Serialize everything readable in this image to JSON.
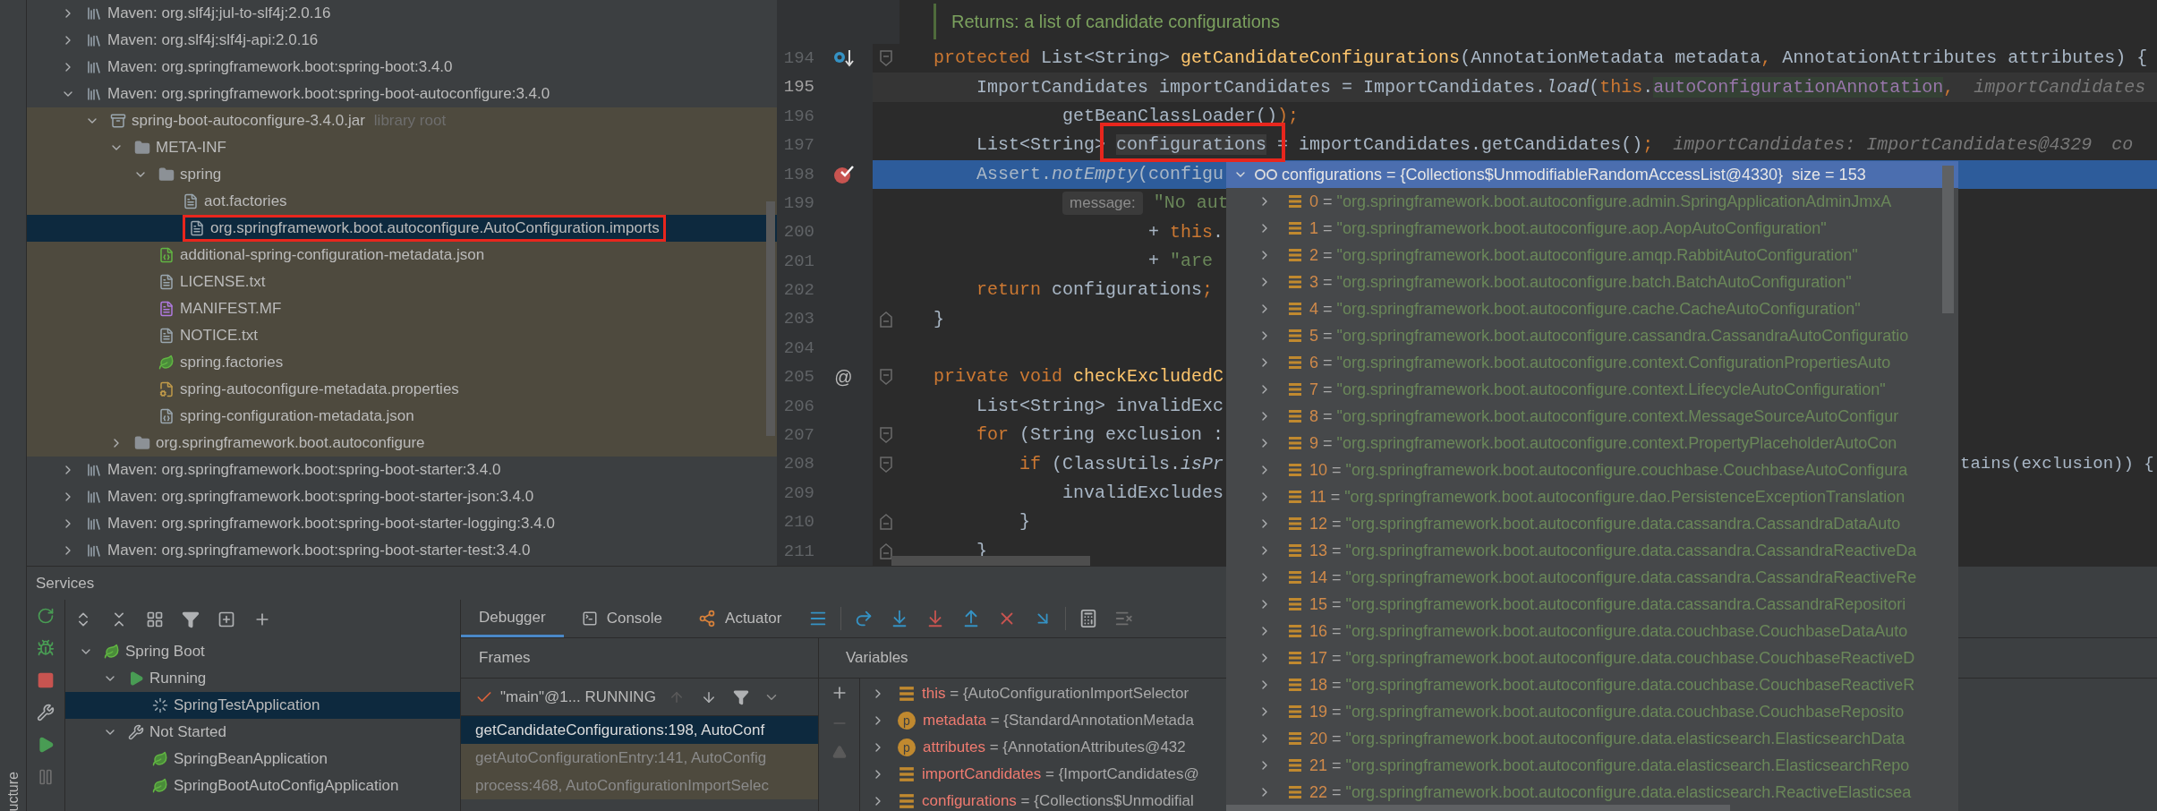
{
  "side_strip": {
    "label": "ucture"
  },
  "project_tree": [
    {
      "label": "Maven: org.slf4j:jul-to-slf4j:2.0.16",
      "kind": "library",
      "expanded": false,
      "selected": false
    },
    {
      "label": "Maven: org.slf4j:slf4j-api:2.0.16",
      "kind": "library",
      "expanded": false,
      "selected": false
    },
    {
      "label": "Maven: org.springframework.boot:spring-boot:3.4.0",
      "kind": "library",
      "expanded": false,
      "selected": false
    },
    {
      "label": "Maven: org.springframework.boot:spring-boot-autoconfigure:3.4.0",
      "kind": "library",
      "expanded": true,
      "selected": false,
      "children": [
        {
          "label": "spring-boot-autoconfigure-3.4.0.jar",
          "hint": "library root",
          "kind": "jar",
          "in_library": true,
          "expanded": true,
          "selected": false,
          "children": [
            {
              "label": "META-INF",
              "kind": "folder",
              "expanded": true,
              "selected": false,
              "children": [
                {
                  "label": "spring",
                  "kind": "folder",
                  "expanded": true,
                  "selected": false,
                  "children": [
                    {
                      "label": "aot.factories",
                      "kind": "file",
                      "selected": false
                    },
                    {
                      "label": "org.springframework.boot.autoconfigure.AutoConfiguration.imports",
                      "kind": "file",
                      "selected": true,
                      "framed": true
                    }
                  ]
                },
                {
                  "label": "additional-spring-configuration-metadata.json",
                  "kind": "spring_json",
                  "selected": false
                },
                {
                  "label": "LICENSE.txt",
                  "kind": "file",
                  "selected": false
                },
                {
                  "label": "MANIFEST.MF",
                  "kind": "manifest",
                  "selected": false
                },
                {
                  "label": "NOTICE.txt",
                  "kind": "file",
                  "selected": false
                },
                {
                  "label": "spring.factories",
                  "kind": "spring",
                  "selected": false
                },
                {
                  "label": "spring-autoconfigure-metadata.properties",
                  "kind": "properties",
                  "selected": false
                },
                {
                  "label": "spring-configuration-metadata.json",
                  "kind": "json",
                  "selected": false
                }
              ]
            },
            {
              "label": "org.springframework.boot.autoconfigure",
              "kind": "folder",
              "expanded": false,
              "selected": false
            }
          ]
        }
      ]
    },
    {
      "label": "Maven: org.springframework.boot:spring-boot-starter:3.4.0",
      "kind": "library",
      "expanded": false,
      "selected": false
    },
    {
      "label": "Maven: org.springframework.boot:spring-boot-starter-json:3.4.0",
      "kind": "library",
      "expanded": false,
      "selected": false
    },
    {
      "label": "Maven: org.springframework.boot:spring-boot-starter-logging:3.4.0",
      "kind": "library",
      "expanded": false,
      "selected": false
    },
    {
      "label": "Maven: org.springframework.boot:spring-boot-starter-test:3.4.0",
      "kind": "library",
      "expanded": false,
      "selected": false
    }
  ],
  "editor": {
    "doc_comment": "Returns: a list of candidate configurations",
    "lines": [
      {
        "number": "194",
        "current": false,
        "execution": false,
        "markers": [
          {
            "kind": "override"
          }
        ],
        "folds": [
          {
            "kind": "start"
          }
        ],
        "tokens": [
          {
            "kind": "keyword",
            "text": "protected"
          },
          {
            "kind": "plain",
            "text": " List<String> "
          },
          {
            "kind": "method",
            "text": "getCandidateConfigurations"
          },
          {
            "kind": "plain",
            "text": "(AnnotationMetadata metadata"
          },
          {
            "kind": "keyword",
            "text": ","
          },
          {
            "kind": "plain",
            "text": " AnnotationAttributes attributes) {"
          }
        ]
      },
      {
        "number": "195",
        "current": true,
        "execution": false,
        "tokens": [
          {
            "kind": "plain",
            "text": "    ImportCandidates importCandidates = ImportCandidates."
          },
          {
            "kind": "italic",
            "text": "load"
          },
          {
            "kind": "plain",
            "text": "("
          },
          {
            "kind": "keyword",
            "text": "this"
          },
          {
            "kind": "plain",
            "text": "."
          },
          {
            "kind": "field_usage",
            "text": "autoConfigurationAnnotation"
          },
          {
            "kind": "keyword",
            "text": ","
          },
          {
            "kind": "hint",
            "text": "importCandidates"
          }
        ]
      },
      {
        "number": "196",
        "current": false,
        "execution": false,
        "tokens": [
          {
            "kind": "plain",
            "text": "            getBeanClassLoader()"
          },
          {
            "kind": "keyword",
            "text": ");"
          }
        ]
      },
      {
        "number": "197",
        "current": false,
        "execution": false,
        "framed": true,
        "tokens": [
          {
            "kind": "plain",
            "text": "    List<String> "
          },
          {
            "kind": "usage",
            "text": "configurations"
          },
          {
            "kind": "plain",
            "text": " = importCandidates.getCandidates()"
          },
          {
            "kind": "keyword",
            "text": ";"
          },
          {
            "kind": "hint",
            "text": "importCandidates: ImportCandidates@4329"
          },
          {
            "kind": "hint",
            "text": "co"
          }
        ]
      },
      {
        "number": "198",
        "current": false,
        "execution": true,
        "markers": [
          {
            "kind": "breakpoint"
          }
        ],
        "tokens": [
          {
            "kind": "plain",
            "text": "    Assert."
          },
          {
            "kind": "italic",
            "text": "notEmpty"
          },
          {
            "kind": "plain",
            "text": "(configu"
          }
        ]
      },
      {
        "number": "199",
        "current": false,
        "execution": false,
        "tokens": [
          {
            "kind": "param_hint",
            "text": "            message:"
          },
          {
            "kind": "string",
            "text": "\"No aut"
          }
        ]
      },
      {
        "number": "200",
        "current": false,
        "execution": false,
        "tokens": [
          {
            "kind": "plain",
            "text": "                    + "
          },
          {
            "kind": "keyword",
            "text": "this"
          },
          {
            "kind": "plain",
            "text": "."
          }
        ]
      },
      {
        "number": "201",
        "current": false,
        "execution": false,
        "tokens": [
          {
            "kind": "plain",
            "text": "                    + "
          },
          {
            "kind": "string",
            "text": "\"are"
          }
        ]
      },
      {
        "number": "202",
        "current": false,
        "execution": false,
        "tokens": [
          {
            "kind": "keyword",
            "text": "    return"
          },
          {
            "kind": "plain",
            "text": " configurations"
          },
          {
            "kind": "keyword",
            "text": ";"
          }
        ]
      },
      {
        "number": "203",
        "current": false,
        "execution": false,
        "folds": [
          {
            "kind": "end"
          }
        ],
        "tokens": [
          {
            "kind": "plain",
            "text": "}"
          }
        ]
      },
      {
        "number": "204",
        "current": false,
        "execution": false
      },
      {
        "number": "205",
        "current": false,
        "execution": false,
        "gutter_text": "@",
        "folds": [
          {
            "kind": "start"
          }
        ],
        "tokens": [
          {
            "kind": "keyword",
            "text": "private void "
          },
          {
            "kind": "method",
            "text": "checkExcludedC"
          }
        ]
      },
      {
        "number": "206",
        "current": false,
        "execution": false,
        "tokens": [
          {
            "kind": "plain",
            "text": "    List<String> invalidExc"
          }
        ]
      },
      {
        "number": "207",
        "current": false,
        "execution": false,
        "folds": [
          {
            "kind": "start"
          }
        ],
        "tokens": [
          {
            "kind": "keyword",
            "text": "    for"
          },
          {
            "kind": "plain",
            "text": " (String exclusion :"
          }
        ]
      },
      {
        "number": "208",
        "current": false,
        "execution": false,
        "folds": [
          {
            "kind": "start"
          }
        ],
        "tail": "tains(exclusion)) {",
        "tokens": [
          {
            "kind": "keyword",
            "text": "        if"
          },
          {
            "kind": "plain",
            "text": " (ClassUtils."
          },
          {
            "kind": "italic",
            "text": "isPr"
          }
        ]
      },
      {
        "number": "209",
        "current": false,
        "execution": false,
        "tokens": [
          {
            "kind": "plain",
            "text": "            invalidExcludes"
          }
        ]
      },
      {
        "number": "210",
        "current": false,
        "execution": false,
        "folds": [
          {
            "kind": "end"
          }
        ],
        "tokens": [
          {
            "kind": "plain",
            "text": "        }"
          }
        ]
      },
      {
        "number": "211",
        "current": false,
        "execution": false,
        "folds": [
          {
            "kind": "end"
          }
        ],
        "tokens": [
          {
            "kind": "plain",
            "text": "    }"
          }
        ]
      }
    ]
  },
  "popup": {
    "header": "configurations = {Collections$UnmodifiableRandomAccessList@4330}  size = 153",
    "expanded": true,
    "items": [
      {
        "index": "0",
        "eq": "=",
        "value": "\"org.springframework.boot.autoconfigure.admin.SpringApplicationAdminJmxA"
      },
      {
        "index": "1",
        "eq": "=",
        "value": "\"org.springframework.boot.autoconfigure.aop.AopAutoConfiguration\""
      },
      {
        "index": "2",
        "eq": "=",
        "value": "\"org.springframework.boot.autoconfigure.amqp.RabbitAutoConfiguration\""
      },
      {
        "index": "3",
        "eq": "=",
        "value": "\"org.springframework.boot.autoconfigure.batch.BatchAutoConfiguration\""
      },
      {
        "index": "4",
        "eq": "=",
        "value": "\"org.springframework.boot.autoconfigure.cache.CacheAutoConfiguration\""
      },
      {
        "index": "5",
        "eq": "=",
        "value": "\"org.springframework.boot.autoconfigure.cassandra.CassandraAutoConfiguratio"
      },
      {
        "index": "6",
        "eq": "=",
        "value": "\"org.springframework.boot.autoconfigure.context.ConfigurationPropertiesAuto"
      },
      {
        "index": "7",
        "eq": "=",
        "value": "\"org.springframework.boot.autoconfigure.context.LifecycleAutoConfiguration\""
      },
      {
        "index": "8",
        "eq": "=",
        "value": "\"org.springframework.boot.autoconfigure.context.MessageSourceAutoConfigur"
      },
      {
        "index": "9",
        "eq": "=",
        "value": "\"org.springframework.boot.autoconfigure.context.PropertyPlaceholderAutoCon"
      },
      {
        "index": "10",
        "eq": "=",
        "value": "\"org.springframework.boot.autoconfigure.couchbase.CouchbaseAutoConfigura"
      },
      {
        "index": "11",
        "eq": "=",
        "value": "\"org.springframework.boot.autoconfigure.dao.PersistenceExceptionTranslation"
      },
      {
        "index": "12",
        "eq": "=",
        "value": "\"org.springframework.boot.autoconfigure.data.cassandra.CassandraDataAuto"
      },
      {
        "index": "13",
        "eq": "=",
        "value": "\"org.springframework.boot.autoconfigure.data.cassandra.CassandraReactiveDa"
      },
      {
        "index": "14",
        "eq": "=",
        "value": "\"org.springframework.boot.autoconfigure.data.cassandra.CassandraReactiveRe"
      },
      {
        "index": "15",
        "eq": "=",
        "value": "\"org.springframework.boot.autoconfigure.data.cassandra.CassandraRepositori"
      },
      {
        "index": "16",
        "eq": "=",
        "value": "\"org.springframework.boot.autoconfigure.data.couchbase.CouchbaseDataAuto"
      },
      {
        "index": "17",
        "eq": "=",
        "value": "\"org.springframework.boot.autoconfigure.data.couchbase.CouchbaseReactiveD"
      },
      {
        "index": "18",
        "eq": "=",
        "value": "\"org.springframework.boot.autoconfigure.data.couchbase.CouchbaseReactiveR"
      },
      {
        "index": "19",
        "eq": "=",
        "value": "\"org.springframework.boot.autoconfigure.data.couchbase.CouchbaseReposito"
      },
      {
        "index": "20",
        "eq": "=",
        "value": "\"org.springframework.boot.autoconfigure.data.elasticsearch.ElasticsearchData"
      },
      {
        "index": "21",
        "eq": "=",
        "value": "\"org.springframework.boot.autoconfigure.data.elasticsearch.ElasticsearchRepo"
      },
      {
        "index": "22",
        "eq": "=",
        "value": "\"org.springframework.boot.autoconfigure.data.elasticsearch.ReactiveElasticsea"
      }
    ]
  },
  "services": {
    "title": "Services",
    "tree": [
      {
        "label": "Spring Boot",
        "kind": "spring",
        "expanded": true,
        "selected": false,
        "children": [
          {
            "label": "Running",
            "kind": "running",
            "expanded": true,
            "selected": false,
            "children": [
              {
                "label": "SpringTestApplication",
                "kind": "spinner",
                "selected": true
              }
            ]
          },
          {
            "label": "Not Started",
            "kind": "wrench",
            "expanded": true,
            "selected": false,
            "children": [
              {
                "label": "SpringBeanApplication",
                "kind": "spring",
                "selected": false
              },
              {
                "label": "SpringBootAutoConfigApplication",
                "kind": "spring",
                "selected": false
              }
            ]
          }
        ]
      }
    ]
  },
  "debugger": {
    "tabs": [
      {
        "label": "Debugger",
        "kind": "plain",
        "selected": true
      },
      {
        "label": "Console",
        "kind": "console",
        "selected": false
      },
      {
        "label": "Actuator",
        "kind": "actuator",
        "selected": false
      }
    ],
    "frames": {
      "title": "Frames",
      "thread": "\"main\"@1... RUNNING",
      "items": [
        {
          "text": "getCandidateConfigurations:198, AutoConf",
          "selected": true,
          "library": false
        },
        {
          "text": "getAutoConfigurationEntry:141, AutoConfig",
          "selected": false,
          "library": true
        },
        {
          "text": "process:468, AutoConfigurationImportSelec",
          "selected": false,
          "library": true
        }
      ]
    },
    "variables": {
      "title": "Variables",
      "items": [
        {
          "kind": "field",
          "name": "this",
          "eq": "=",
          "value": "{AutoConfigurationImportSelector"
        },
        {
          "kind": "param",
          "badge": "p",
          "name": "metadata",
          "eq": "=",
          "value": "{StandardAnnotationMetada"
        },
        {
          "kind": "param",
          "badge": "p",
          "name": "attributes",
          "eq": "=",
          "value": "{AnnotationAttributes@432"
        },
        {
          "kind": "field",
          "name": "importCandidates",
          "eq": "=",
          "value": "{ImportCandidates@"
        },
        {
          "kind": "field",
          "name": "configurations",
          "eq": "=",
          "value": "{Collections$Unmodifial"
        }
      ]
    }
  }
}
